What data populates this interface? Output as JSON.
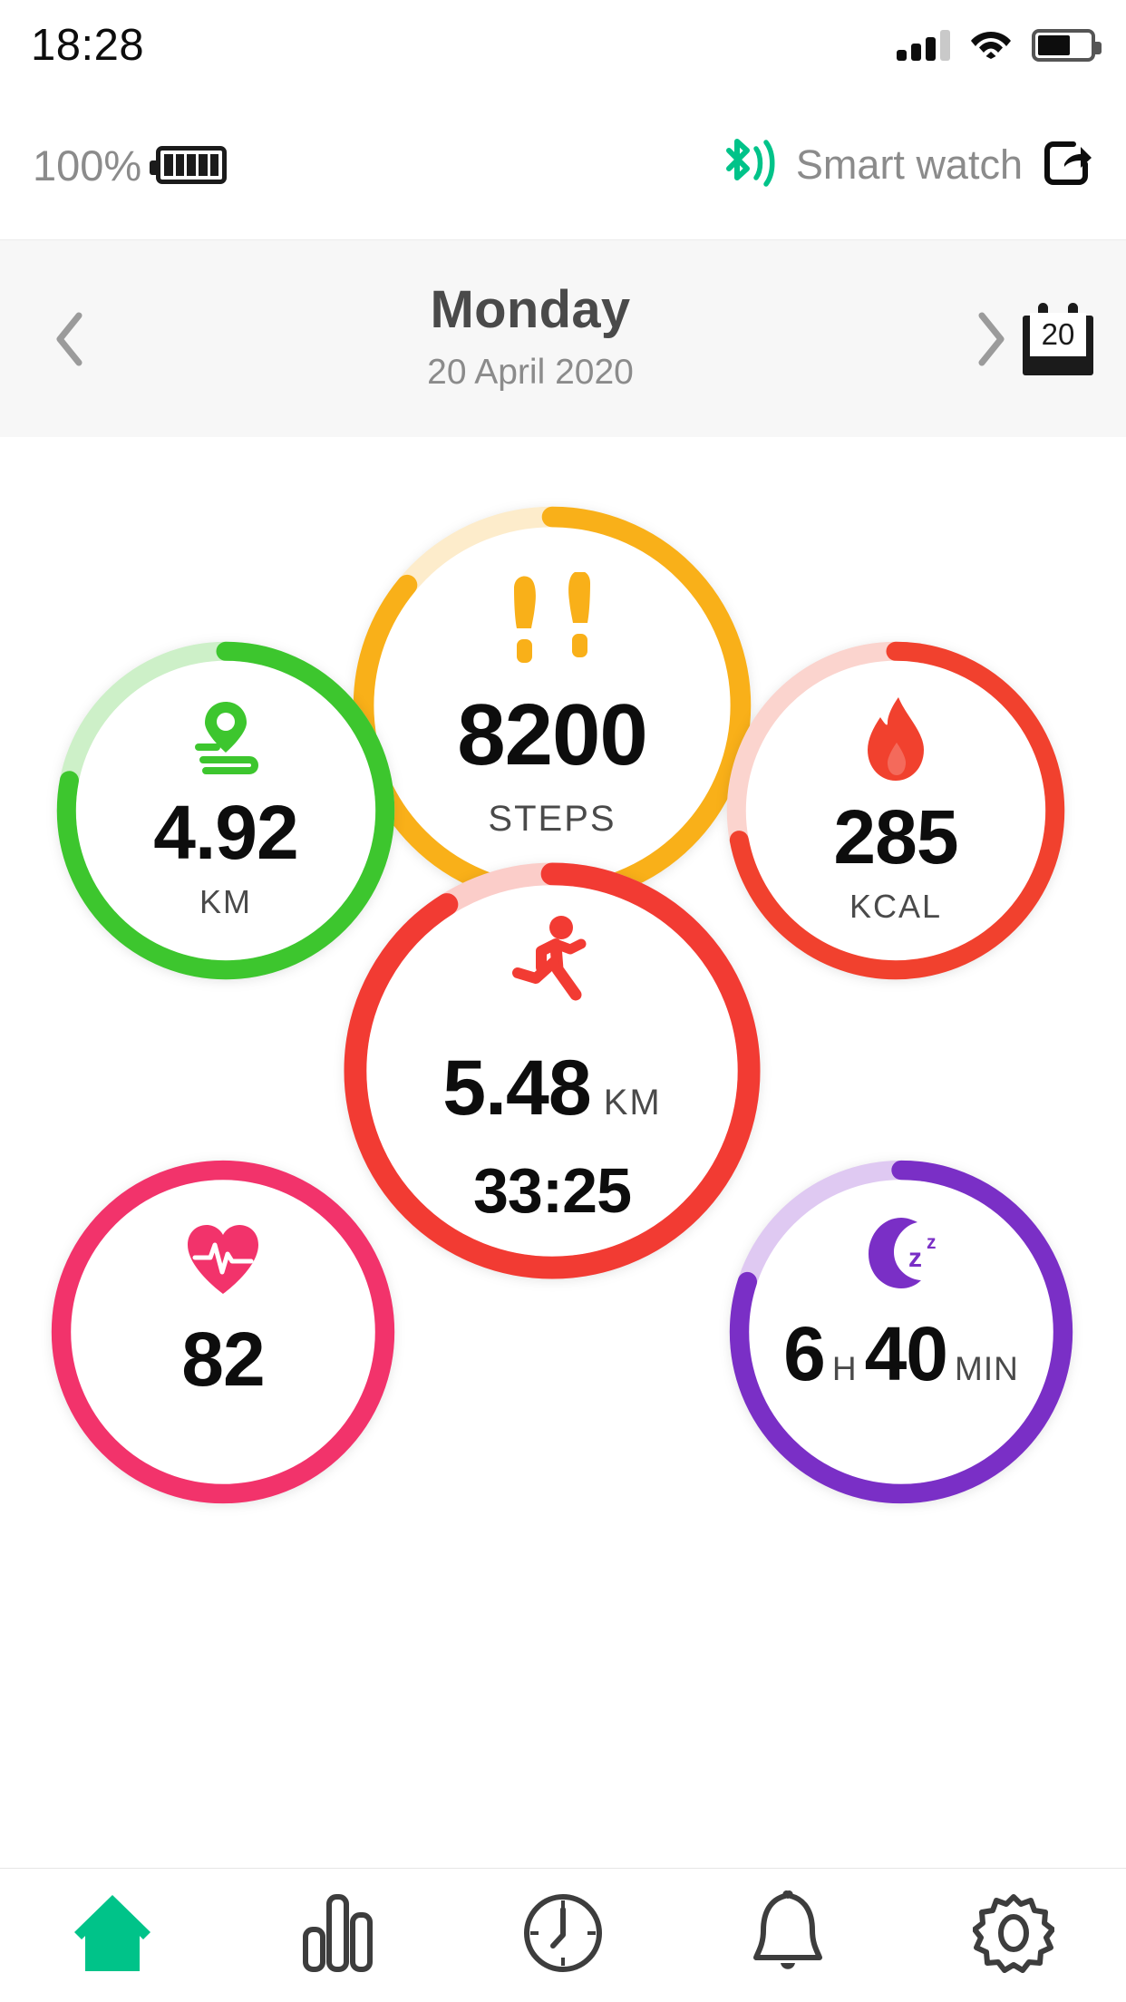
{
  "status_bar": {
    "time": "18:28",
    "signal_icon": "signal-bars-icon",
    "signal_bars_filled": 3,
    "signal_bars_total": 4,
    "wifi_icon": "wifi-icon",
    "battery_icon": "battery-icon",
    "battery_level_pct": 62
  },
  "device_bar": {
    "battery_percent": "100%",
    "battery_icon": "battery-full-icon",
    "bluetooth_icon": "bluetooth-icon",
    "device_name": "Smart watch",
    "share_icon": "share-icon",
    "bluetooth_color": "#00c389"
  },
  "date_header": {
    "prev_icon": "chevron-left-icon",
    "next_icon": "chevron-right-icon",
    "day_name": "Monday",
    "full_date": "20 April 2020",
    "calendar_icon": "calendar-icon",
    "calendar_day": "20"
  },
  "metrics": {
    "steps": {
      "icon": "footprints-icon",
      "value": "8200",
      "unit": "STEPS",
      "color": "#f9b019",
      "track_color": "#fdeccb",
      "progress_pct": 86
    },
    "distance": {
      "icon": "route-pin-icon",
      "value": "4.92",
      "unit": "KM",
      "color": "#3dc62e",
      "track_color": "#cdf0c8",
      "progress_pct": 78
    },
    "calories": {
      "icon": "flame-icon",
      "value": "285",
      "unit": "KCAL",
      "color": "#f1412e",
      "track_color": "#fbd4ce",
      "progress_pct": 72
    },
    "running": {
      "icon": "runner-icon",
      "value": "5.48",
      "unit": "KM",
      "duration": "33:25",
      "color": "#f23b33",
      "track_color": "#fbcdc9",
      "progress_pct": 91
    },
    "heart_rate": {
      "icon": "heart-pulse-icon",
      "value": "82",
      "color": "#f2336b",
      "track_color": "#fbcbd9",
      "progress_pct": 100
    },
    "sleep": {
      "icon": "moon-zzz-icon",
      "hours": "6",
      "hours_unit": "H",
      "minutes": "40",
      "minutes_unit": "MIN",
      "color": "#7a2fc6",
      "track_color": "#dfc9f2",
      "progress_pct": 80
    }
  },
  "tab_bar": {
    "active_color": "#00c389",
    "inactive_color": "#3d3d3d",
    "items": [
      {
        "name": "home",
        "icon": "home-icon",
        "active": true
      },
      {
        "name": "statistics",
        "icon": "bar-chart-icon",
        "active": false
      },
      {
        "name": "history",
        "icon": "clock-icon",
        "active": false
      },
      {
        "name": "alarms",
        "icon": "bell-icon",
        "active": false
      },
      {
        "name": "settings",
        "icon": "gear-icon",
        "active": false
      }
    ]
  }
}
